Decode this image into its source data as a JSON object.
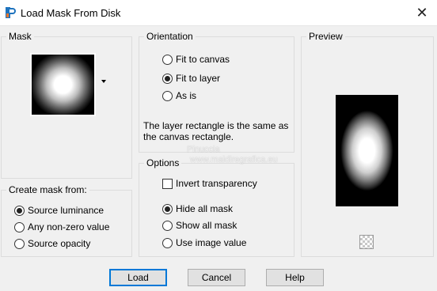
{
  "window": {
    "title": "Load Mask From Disk",
    "close_label": "✕"
  },
  "mask_group": {
    "label": "Mask"
  },
  "create_group": {
    "label": "Create mask from:",
    "options": [
      {
        "label": "Source luminance",
        "checked": true
      },
      {
        "label": "Any non-zero value",
        "checked": false
      },
      {
        "label": "Source opacity",
        "checked": false
      }
    ]
  },
  "orientation_group": {
    "label": "Orientation",
    "options": [
      {
        "label": "Fit to canvas",
        "checked": false
      },
      {
        "label": "Fit to layer",
        "checked": true
      },
      {
        "label": "As is",
        "checked": false
      }
    ],
    "info": "The layer rectangle is the same as the canvas rectangle."
  },
  "options_group": {
    "label": "Options",
    "invert_label": "Invert transparency",
    "invert_checked": false,
    "options": [
      {
        "label": "Hide all mask",
        "checked": true
      },
      {
        "label": "Show all mask",
        "checked": false
      },
      {
        "label": "Use image value",
        "checked": false
      }
    ]
  },
  "preview_group": {
    "label": "Preview"
  },
  "watermark": {
    "line1": "Pinuccia",
    "line2": "www.maidiregrafica.eu"
  },
  "buttons": {
    "load": "Load",
    "cancel": "Cancel",
    "help": "Help"
  },
  "icons": {
    "app": "paintshop-pro-icon",
    "preview_toggle": "checkerboard-icon"
  }
}
